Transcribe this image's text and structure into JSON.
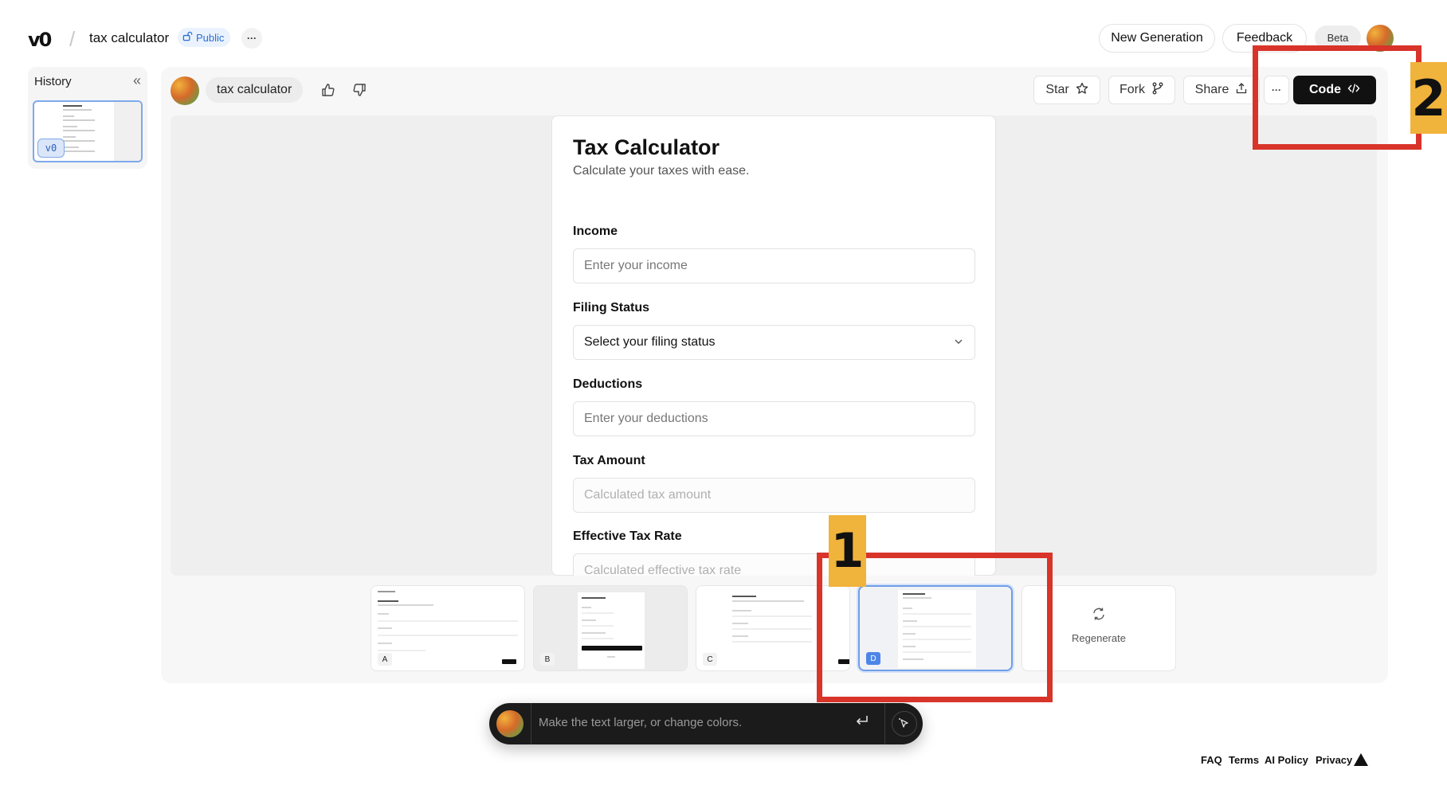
{
  "header": {
    "logo": "v0",
    "project_name": "tax calculator",
    "visibility": "Public",
    "more": "···",
    "new_generation": "New Generation",
    "feedback": "Feedback",
    "beta": "Beta"
  },
  "history": {
    "title": "History",
    "collapse_icon": "«",
    "version_badge": "v0"
  },
  "chat": {
    "title": "tax calculator",
    "thumbs_up_icon": "thumbs-up-icon",
    "thumbs_down_icon": "thumbs-down-icon",
    "star": "Star",
    "fork": "Fork",
    "share": "Share",
    "more": "···",
    "code": "Code"
  },
  "preview": {
    "title": "Tax Calculator",
    "subtitle": "Calculate your taxes with ease.",
    "fields": [
      {
        "label": "Income",
        "placeholder": "Enter your income"
      },
      {
        "label": "Filing Status",
        "value": "Select your filing status"
      },
      {
        "label": "Deductions",
        "placeholder": "Enter your deductions"
      },
      {
        "label": "Tax Amount",
        "placeholder": "Calculated tax amount"
      },
      {
        "label": "Effective Tax Rate",
        "placeholder": "Calculated effective tax rate"
      }
    ]
  },
  "variants": {
    "items": [
      {
        "letter": "A",
        "selected": false
      },
      {
        "letter": "B",
        "selected": false
      },
      {
        "letter": "C",
        "selected": false
      },
      {
        "letter": "D",
        "selected": true
      }
    ],
    "regenerate": "Regenerate"
  },
  "prompt": {
    "placeholder": "Make the text larger, or change colors."
  },
  "footer": {
    "faq": "FAQ",
    "terms": "Terms",
    "ai_policy": "AI Policy",
    "privacy": "Privacy"
  },
  "annotations": [
    {
      "number": "1"
    },
    {
      "number": "2"
    }
  ],
  "colors": {
    "annotation_box": "#d8342a",
    "annotation_label": "#f0b33b",
    "public_badge": "#2a6fd6",
    "selected_variant": "#4e86e8"
  }
}
